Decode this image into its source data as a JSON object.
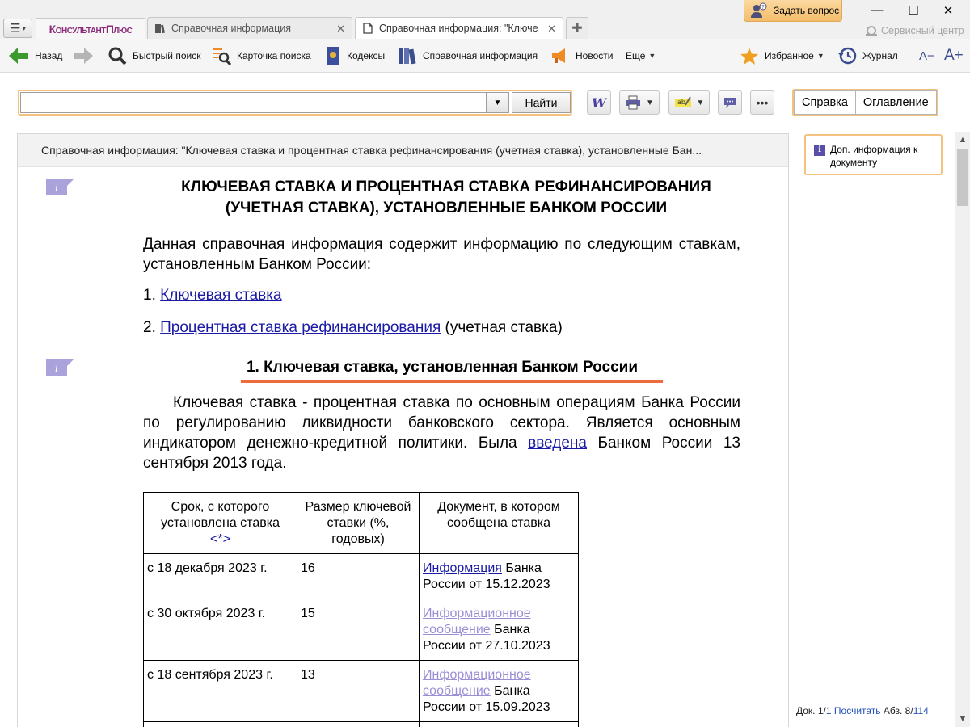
{
  "app": {
    "brand": "КонсультантПлюс",
    "ask_label": "Задать вопрос",
    "service_label": "Сервисный центр",
    "tabs": [
      {
        "label": "Справочная информация"
      },
      {
        "label": "Справочная информация: \"Ключевая ставка и процентная ставка рефинансирования\""
      }
    ]
  },
  "toolbar": {
    "back": "Назад",
    "quick_search": "Быстрый поиск",
    "search_card": "Карточка поиска",
    "codes": "Кодексы",
    "reference": "Справочная информация",
    "news": "Новости",
    "more": "Еще",
    "favorites": "Избранное",
    "journal": "Журнал",
    "font_smaller": "A−",
    "font_larger": "A+"
  },
  "search": {
    "value": "",
    "find_label": "Найти",
    "right_tabs": [
      "Справка",
      "Оглавление"
    ]
  },
  "document": {
    "header": "Справочная информация: \"Ключевая ставка и процентная ставка рефинансирования (учетная ставка), установленные Бан...",
    "title_line1": "КЛЮЧЕВАЯ СТАВКА И ПРОЦЕНТНАЯ СТАВКА РЕФИНАНСИРОВАНИЯ",
    "title_line2": "(УЧЕТНАЯ СТАВКА), УСТАНОВЛЕННЫЕ БАНКОМ РОССИИ",
    "intro": "Данная справочная информация содержит информацию по следующим ставкам, установленным Банком России:",
    "list": [
      {
        "num": "1.",
        "link": "Ключевая ставка",
        "rest": ""
      },
      {
        "num": "2.",
        "link": "Процентная ставка рефинансирования",
        "rest": " (учетная ставка)"
      }
    ],
    "section1_title": "1. Ключевая ставка, установленная Банком России",
    "section1_text_a": "Ключевая ставка - процентная ставка по основным операциям Банка России по регулированию ликвидности банковского сектора. Является основным индикатором денежно-кредитной политики. Была ",
    "section1_link": "введена",
    "section1_text_b": "Банком России 13 сентября 2013 года.",
    "table": {
      "headers": [
        "Срок, с которого установлена ставка",
        "Размер ключевой ставки (%, годовых)",
        "Документ, в котором сообщена ставка"
      ],
      "header_note_link": "<*>",
      "rows": [
        {
          "date": "с 18 декабря 2023 г.",
          "rate": "16",
          "doc_link": "Информация",
          "doc_rest": " Банка России от 15.12.2023"
        },
        {
          "date": "с 30 октября 2023 г.",
          "rate": "15",
          "doc_link": "Информационное сообщение",
          "doc_rest": " Банка России от 27.10.2023"
        },
        {
          "date": "с 18 сентября 2023 г.",
          "rate": "13",
          "doc_link": "Информационное сообщение",
          "doc_rest": " Банка России от 15.09.2023"
        }
      ]
    }
  },
  "side": {
    "addinfo": "Доп. информация к документу",
    "status_doc": "Док. 1/",
    "status_doc_total": "1",
    "status_count": "Посчитать",
    "status_para": "Абз. 8/",
    "status_para_total": "114"
  },
  "colors": {
    "accent_orange": "#f4c27f",
    "underline": "#ef6a3c",
    "link": "#1a1aa6",
    "visited_link": "#9b8ed4",
    "info_marker": "#a9a2db"
  }
}
